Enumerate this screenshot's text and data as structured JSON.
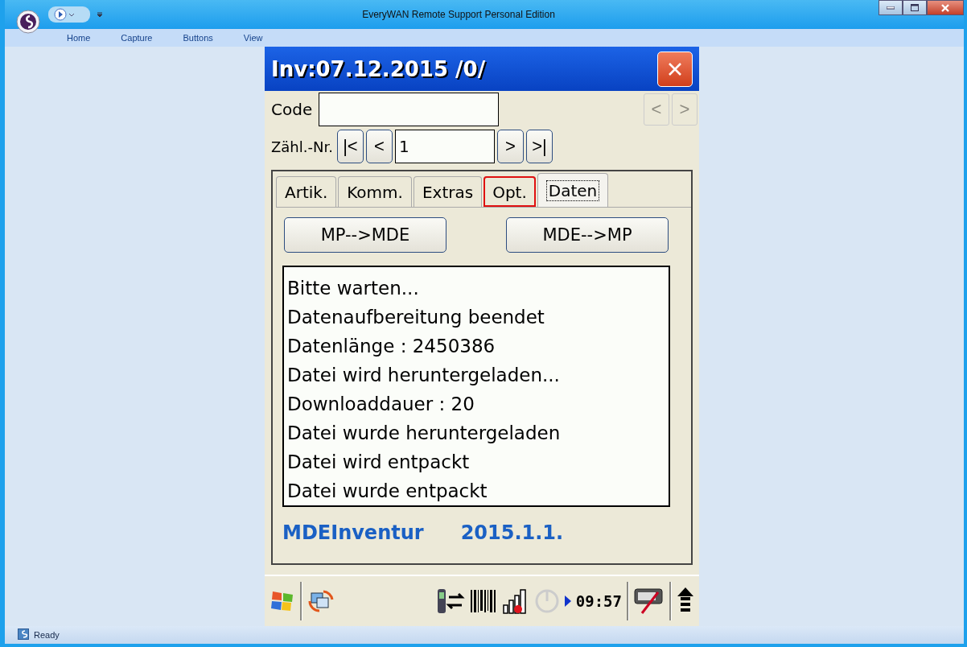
{
  "window": {
    "title": "EveryWAN Remote Support Personal Edition"
  },
  "ribbon_tabs": [
    {
      "label": "Home"
    },
    {
      "label": "Capture"
    },
    {
      "label": "Buttons"
    },
    {
      "label": "View"
    }
  ],
  "device": {
    "title": "Inv:07.12.2015 /0/",
    "code": {
      "label": "Code",
      "nav": [
        {
          "label": "<",
          "disabled": true
        },
        {
          "label": ">",
          "disabled": true
        }
      ]
    },
    "counter": {
      "label": "Zähl.-Nr.",
      "value": "1",
      "buttons_before": [
        "|<",
        "<"
      ],
      "buttons_after": [
        ">",
        ">|"
      ]
    },
    "tabs": [
      {
        "label": "Artik.",
        "selected": false,
        "highlighted": false
      },
      {
        "label": "Komm.",
        "selected": false,
        "highlighted": false
      },
      {
        "label": "Extras",
        "selected": false,
        "highlighted": false
      },
      {
        "label": "Opt.",
        "selected": false,
        "highlighted": true
      },
      {
        "label": "Daten",
        "selected": true,
        "highlighted": false
      }
    ],
    "actions": [
      "MP-->MDE",
      "MDE-->MP"
    ],
    "log": [
      "Bitte warten...",
      "Datenaufbereitung beendet",
      "Datenlänge : 2450386",
      "Datei wird heruntergeladen...",
      "Downloaddauer : 20",
      "Datei wurde heruntergeladen",
      "Datei wird entpackt",
      "Datei wurde entpackt"
    ],
    "app_name": "MDEInventur",
    "version": "2015.1.1.",
    "taskbar": {
      "time": "09:57"
    }
  },
  "status_bar": {
    "text": "Ready"
  }
}
